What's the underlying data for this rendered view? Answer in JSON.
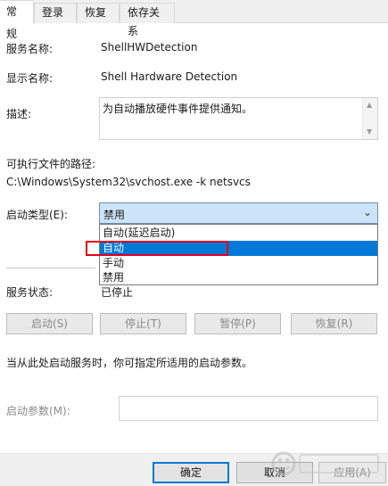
{
  "tabs": [
    {
      "label": "常规",
      "active": true
    },
    {
      "label": "登录",
      "active": false
    },
    {
      "label": "恢复",
      "active": false
    },
    {
      "label": "依存关系",
      "active": false
    }
  ],
  "service": {
    "name_label": "服务名称:",
    "name_value": "ShellHWDetection",
    "display_label": "显示名称:",
    "display_value": "Shell Hardware Detection",
    "desc_label": "描述:",
    "desc_value": "为自动播放硬件事件提供通知。",
    "path_label": "可执行文件的路径:",
    "path_value": "C:\\Windows\\System32\\svchost.exe -k netsvcs"
  },
  "startup": {
    "label": "启动类型(E):",
    "value": "禁用",
    "options": [
      "自动(延迟启动)",
      "自动",
      "手动",
      "禁用"
    ],
    "highlighted": "自动"
  },
  "status": {
    "label": "服务状态:",
    "value": "已停止"
  },
  "controls": {
    "start": "启动(S)",
    "stop": "停止(T)",
    "pause": "暂停(P)",
    "resume": "恢复(R)"
  },
  "params": {
    "hint": "当从此处启动服务时，你可指定所适用的启动参数。",
    "label": "启动参数(M):",
    "value": ""
  },
  "footer": {
    "ok": "确定",
    "cancel": "取消",
    "apply": "应用(A)"
  },
  "colors": {
    "accent": "#0078d7",
    "highlight_box": "#e0001b",
    "combo_bg": "#cce4f7"
  }
}
